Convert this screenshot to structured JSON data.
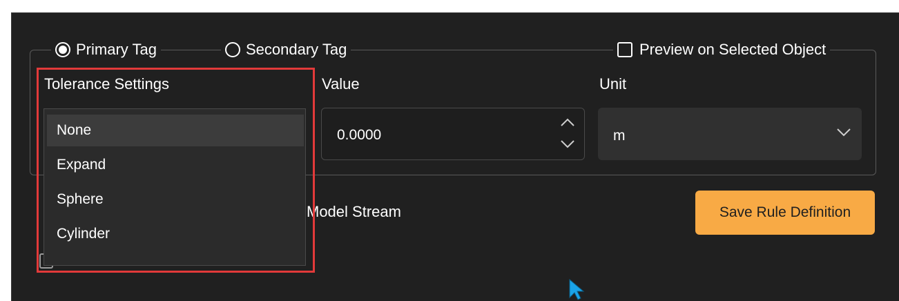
{
  "legend": {
    "primary_tag": "Primary Tag",
    "secondary_tag": "Secondary Tag",
    "preview": "Preview on Selected Object"
  },
  "columns": {
    "tolerance": "Tolerance Settings",
    "value": "Value",
    "unit": "Unit"
  },
  "value_field": {
    "value": "0.0000"
  },
  "unit_field": {
    "value": "m"
  },
  "tolerance_dropdown": {
    "items": [
      "None",
      "Expand",
      "Sphere",
      "Cylinder"
    ],
    "highlighted": "None"
  },
  "behind_text": "Model Stream",
  "save_button": "Save Rule Definition",
  "colors": {
    "background": "#202020",
    "accent_button": "#f8aa45",
    "highlight_border": "#e23a3a",
    "cursor": "#1aa3e8"
  },
  "icons": [
    "radio-icon",
    "checkbox-icon",
    "chevron-up-icon",
    "chevron-down-icon",
    "cursor-icon"
  ]
}
